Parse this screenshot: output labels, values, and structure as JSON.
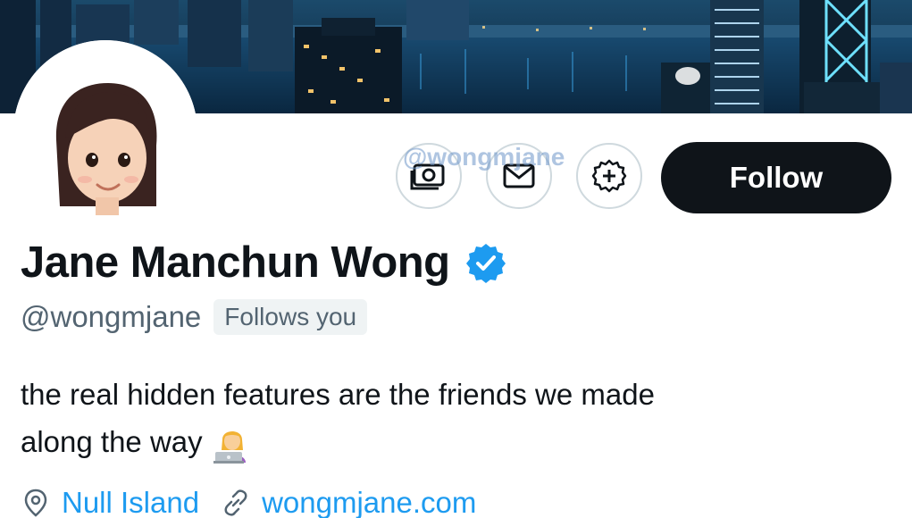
{
  "banner": {
    "description_icon": "city-skyline-night-photo"
  },
  "avatar": {
    "icon": "memoji-avatar-icon"
  },
  "watermark": {
    "text": "@wongmjane"
  },
  "actions": {
    "tip_icon": "money-icon",
    "message_icon": "mail-icon",
    "subscribe_icon": "add-circle-icon",
    "follow_label": "Follow"
  },
  "profile": {
    "display_name": "Jane Manchun Wong",
    "verified_icon": "verified-badge-icon",
    "handle": "@wongmjane",
    "follows_you": "Follows you",
    "bio_line1": "the real hidden features are the friends we made",
    "bio_line2": "along the way",
    "bio_emoji": "woman-technologist-emoji",
    "location_icon": "location-pin-icon",
    "location": "Null Island",
    "website_icon": "link-icon",
    "website": "wongmjane.com"
  },
  "colors": {
    "primary_text": "#0f1419",
    "secondary_text": "#536471",
    "link": "#1d9bf0",
    "follow_bg": "#0f1419",
    "border": "#cfd9de",
    "badge_bg": "#eff3f4"
  }
}
